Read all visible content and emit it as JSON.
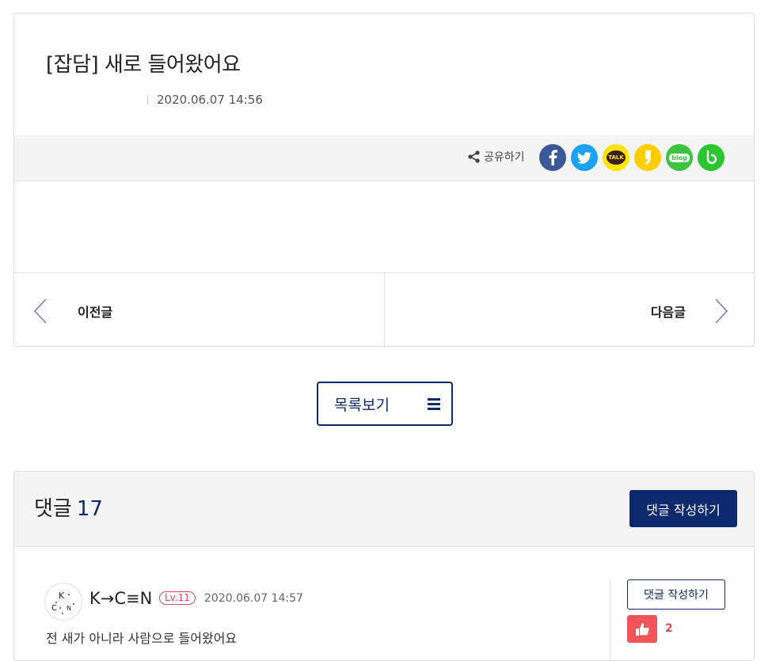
{
  "post": {
    "title": "[잡담] 새로 들어왔어요",
    "date": "2020.06.07 14:56"
  },
  "share": {
    "label": "공유하기",
    "icons": [
      "facebook-icon",
      "twitter-icon",
      "kakaotalk-icon",
      "kakaostory-icon",
      "naver-blog-icon",
      "band-icon"
    ],
    "kakao_talk_text": "TALK",
    "blog_text": "blog",
    "colors": {
      "facebook": "#3b5998",
      "twitter": "#1da1f2",
      "kakaotalk": "#fee500",
      "kakaostory": "#ffcd00",
      "blog": "#3ec33f",
      "band": "#2bc730"
    }
  },
  "nav": {
    "prev_label": "이전글",
    "next_label": "다음글"
  },
  "list_button": {
    "label": "목록보기",
    "icon": "hamburger-icon"
  },
  "comments": {
    "title": "댓글",
    "count": "17",
    "write_button": "댓글 작성하기",
    "items": [
      {
        "author": "K→C≡N",
        "level": "Lv.11",
        "time": "2020.06.07 14:57",
        "text": "전 새가 아니라 사람으로 들어왔어요",
        "reply_button": "댓글 작성하기",
        "likes": "2"
      }
    ]
  },
  "colors": {
    "accent": "#0f2a6b",
    "like": "#f0555a",
    "level_badge": "#e0485a"
  }
}
